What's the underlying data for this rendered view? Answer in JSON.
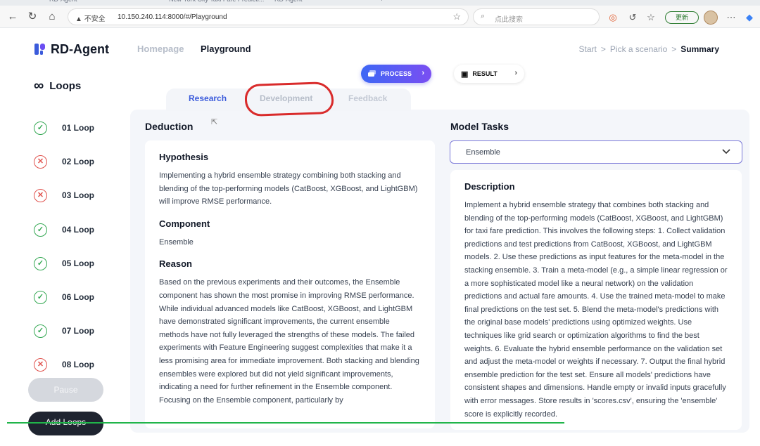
{
  "browser": {
    "tabs": [
      "RD-Agent",
      "New York City Taxi Fare Predicti...",
      "RD-Agent",
      "+"
    ],
    "security_label": "不安全",
    "url": "10.150.240.114:8000/#/Playground",
    "search_placeholder": "点此搜索",
    "update_label": "更新"
  },
  "app": {
    "logo_text": "RD-Agent",
    "nav": {
      "home": "Homepage",
      "playground": "Playground"
    },
    "breadcrumb": {
      "start": "Start",
      "pick": "Pick a scenario",
      "summary": "Summary",
      "sep": ">"
    },
    "process_label": "PROCESS",
    "result_label": "RESULT",
    "tabs": {
      "research": "Research",
      "development": "Development",
      "feedback": "Feedback"
    }
  },
  "sidebar": {
    "title": "Loops",
    "loops": [
      {
        "label": "01 Loop",
        "status": "success"
      },
      {
        "label": "02 Loop",
        "status": "failed"
      },
      {
        "label": "03 Loop",
        "status": "failed"
      },
      {
        "label": "04 Loop",
        "status": "success"
      },
      {
        "label": "05 Loop",
        "status": "success"
      },
      {
        "label": "06 Loop",
        "status": "success"
      },
      {
        "label": "07 Loop",
        "status": "success"
      },
      {
        "label": "08 Loop",
        "status": "failed"
      }
    ],
    "pause_label": "Pause",
    "add_label": "Add Loops"
  },
  "deduction": {
    "title": "Deduction",
    "hypothesis_title": "Hypothesis",
    "hypothesis_text": "Implementing a hybrid ensemble strategy combining both stacking and blending of the top-performing models (CatBoost, XGBoost, and LightGBM) will improve RMSE performance.",
    "component_title": "Component",
    "component_value": "Ensemble",
    "reason_title": "Reason",
    "reason_text": "Based on the previous experiments and their outcomes, the Ensemble component has shown the most promise in improving RMSE performance. While individual advanced models like CatBoost, XGBoost, and LightGBM have demonstrated significant improvements, the current ensemble methods have not fully leveraged the strengths of these models. The failed experiments with Feature Engineering suggest complexities that make it a less promising area for immediate improvement. Both stacking and blending ensembles were explored but did not yield significant improvements, indicating a need for further refinement in the Ensemble component. Focusing on the Ensemble component, particularly by"
  },
  "model_tasks": {
    "title": "Model Tasks",
    "selected": "Ensemble",
    "description_title": "Description",
    "description_text": "Implement a hybrid ensemble strategy that combines both stacking and blending of the top-performing models (CatBoost, XGBoost, and LightGBM) for taxi fare prediction. This involves the following steps: 1. Collect validation predictions and test predictions from CatBoost, XGBoost, and LightGBM models. 2. Use these predictions as input features for the meta-model in the stacking ensemble. 3. Train a meta-model (e.g., a simple linear regression or a more sophisticated model like a neural network) on the validation predictions and actual fare amounts. 4. Use the trained meta-model to make final predictions on the test set. 5. Blend the meta-model's predictions with the original base models' predictions using optimized weights. Use techniques like grid search or optimization algorithms to find the best weights. 6. Evaluate the hybrid ensemble performance on the validation set and adjust the meta-model or weights if necessary. 7. Output the final hybrid ensemble prediction for the test set. Ensure all models' predictions have consistent shapes and dimensions. Handle empty or invalid inputs gracefully with error messages. Store results in 'scores.csv', ensuring the 'ensemble' score is explicitly recorded."
  },
  "colors": {
    "accent": "#3b5bdb",
    "success": "#34a853",
    "failed": "#e0524d",
    "annotation": "#d92b2b"
  }
}
